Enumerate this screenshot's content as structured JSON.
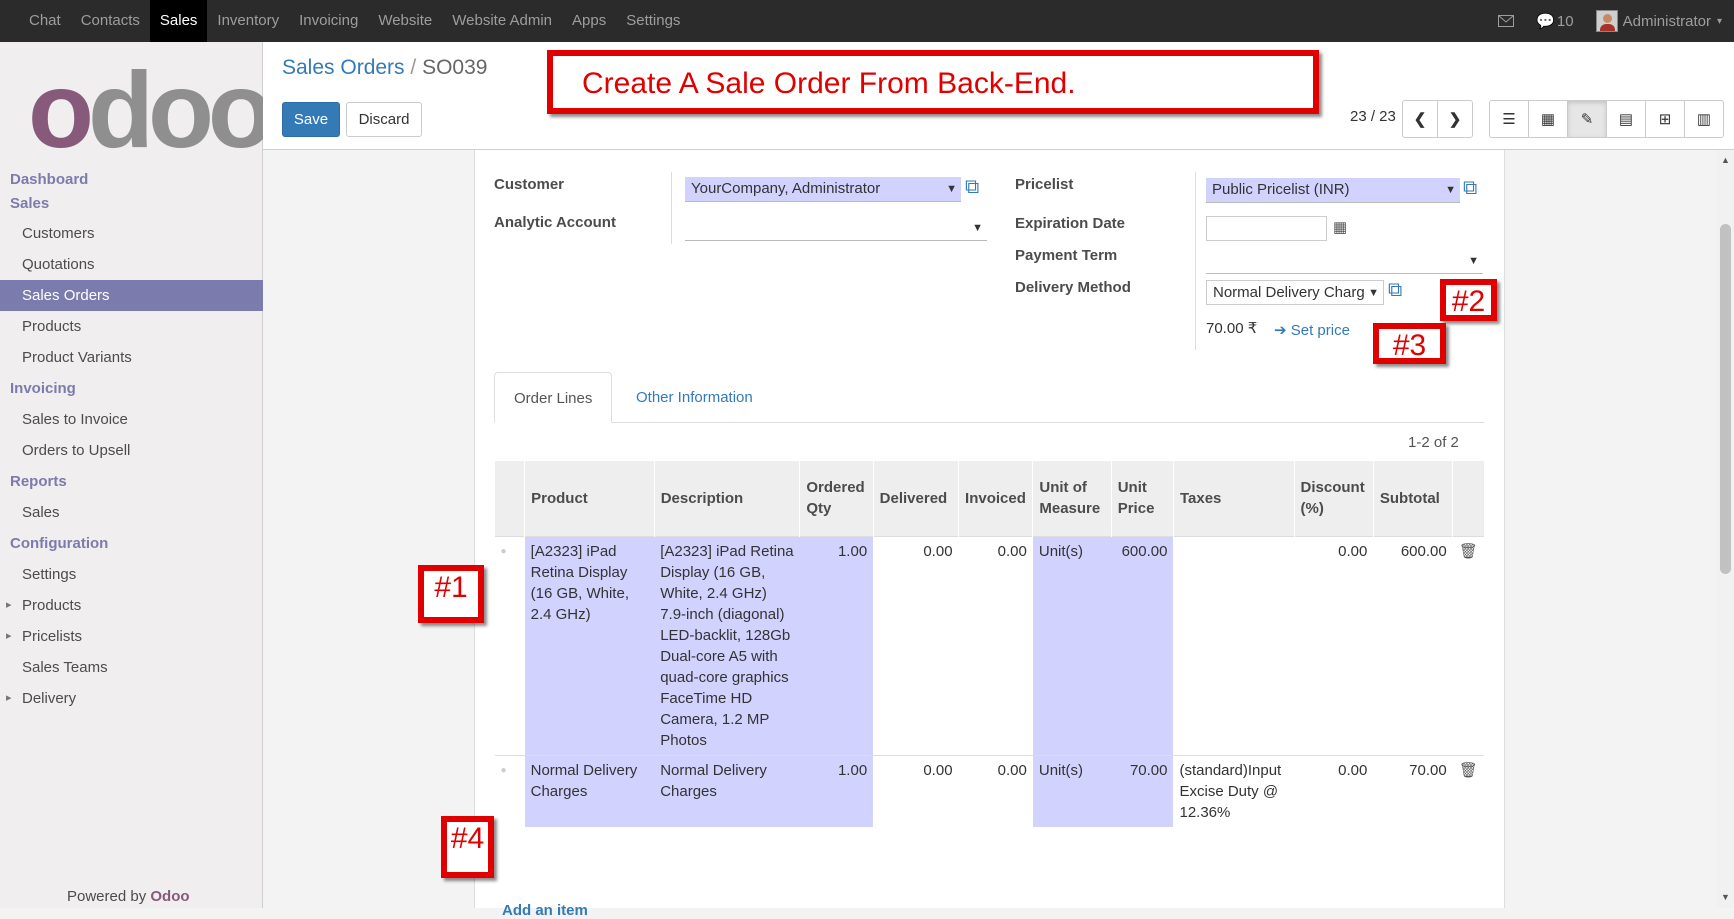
{
  "topbar": {
    "menu": [
      "Chat",
      "Contacts",
      "Sales",
      "Inventory",
      "Invoicing",
      "Website",
      "Website Admin",
      "Apps",
      "Settings"
    ],
    "active": "Sales",
    "messages_count": "10",
    "user": "Administrator"
  },
  "sidebar": {
    "logo_o": "o",
    "logo_doo": "doo",
    "dashboard": "Dashboard",
    "sales_header": "Sales",
    "sales_items": [
      "Customers",
      "Quotations",
      "Sales Orders",
      "Products",
      "Product Variants"
    ],
    "invoicing_header": "Invoicing",
    "invoicing_items": [
      "Sales to Invoice",
      "Orders to Upsell"
    ],
    "reports_header": "Reports",
    "reports_items": [
      "Sales"
    ],
    "config_header": "Configuration",
    "config_items": [
      "Settings",
      "Products",
      "Pricelists",
      "Sales Teams",
      "Delivery"
    ],
    "powered_prefix": "Powered by",
    "powered_brand": "Odoo"
  },
  "control": {
    "crumb_parent": "Sales Orders",
    "crumb_sep": "/",
    "crumb_current": "SO039",
    "save": "Save",
    "discard": "Discard",
    "pager": "23 / 23"
  },
  "annotations": {
    "title": "Create A Sale Order From Back-End.",
    "tag1": "#1",
    "tag2": "#2",
    "tag3": "#3",
    "tag4": "#4"
  },
  "form": {
    "customer_label": "Customer",
    "customer_value": "YourCompany, Administrator",
    "analytic_label": "Analytic Account",
    "analytic_value": "",
    "pricelist_label": "Pricelist",
    "pricelist_value": "Public Pricelist (INR)",
    "expiration_label": "Expiration Date",
    "expiration_value": "",
    "payment_label": "Payment Term",
    "payment_value": "",
    "delivery_label": "Delivery Method",
    "delivery_value": "Normal Delivery Charg",
    "delivery_price": "70.00 ₹",
    "set_price": "Set price"
  },
  "tabs": {
    "order_lines": "Order Lines",
    "other_info": "Other Information"
  },
  "lines": {
    "count": "1-2 of 2",
    "headers": [
      "Product",
      "Description",
      "Ordered Qty",
      "Delivered",
      "Invoiced",
      "Unit of Measure",
      "Unit Price",
      "Taxes",
      "Discount (%)",
      "Subtotal"
    ],
    "rows": [
      {
        "product": "[A2323] iPad Retina Display (16 GB, White, 2.4 GHz)",
        "description": [
          "[A2323] iPad Retina Display (16 GB, White, 2.4 GHz)",
          "7.9-inch (diagonal) LED-backlit, 128Gb",
          "Dual-core A5 with quad-core graphics",
          "FaceTime HD Camera, 1.2 MP Photos"
        ],
        "qty": "1.00",
        "delivered": "0.00",
        "invoiced": "0.00",
        "uom": "Unit(s)",
        "price": "600.00",
        "taxes": "",
        "discount": "0.00",
        "subtotal": "600.00"
      },
      {
        "product": "Normal Delivery Charges",
        "description": [
          "Normal Delivery Charges"
        ],
        "qty": "1.00",
        "delivered": "0.00",
        "invoiced": "0.00",
        "uom": "Unit(s)",
        "price": "70.00",
        "taxes": "(standard)Input Excise Duty @ 12.36%",
        "discount": "0.00",
        "subtotal": "70.00"
      }
    ],
    "add_item": "Add an item"
  }
}
